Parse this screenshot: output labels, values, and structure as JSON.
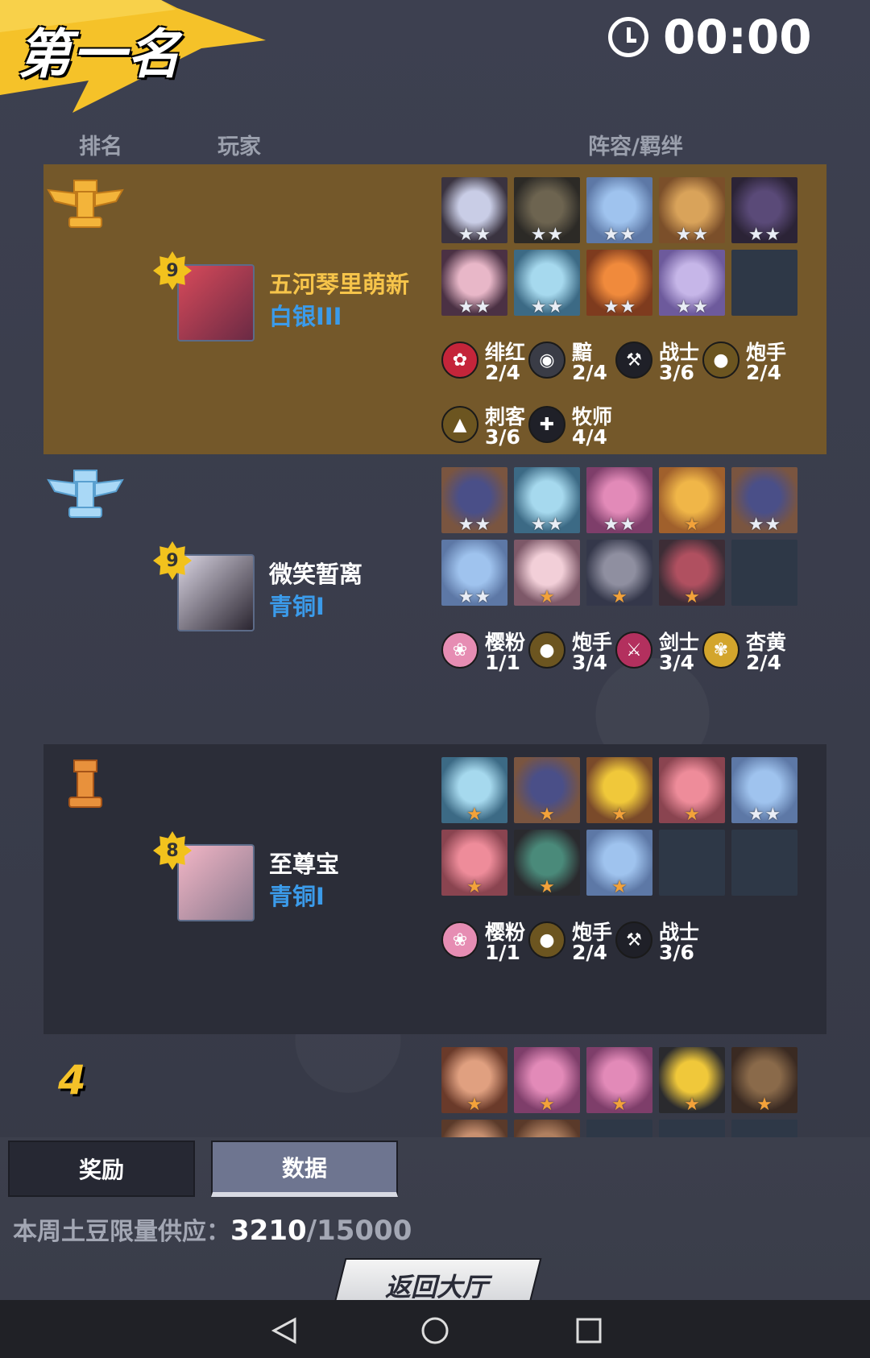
{
  "header": {
    "title": "第一名",
    "timer": "00:00",
    "clock_icon": "clock-icon"
  },
  "columns": {
    "rank": "排名",
    "player": "玩家",
    "lineup": "阵容/羁绊"
  },
  "rows": [
    {
      "rank_icon": "gold-rook-winged-icon",
      "level": "9",
      "name": "五河琴里萌新",
      "tier": "白银III",
      "name_color": "#f6c44a",
      "units": [
        {
          "c1": "#c9cde6",
          "c2": "#3a3340",
          "stars": 2,
          "gold": false
        },
        {
          "c1": "#6d6450",
          "c2": "#2c2a26",
          "stars": 2,
          "gold": false
        },
        {
          "c1": "#9fc3ee",
          "c2": "#5d78a6",
          "stars": 2,
          "gold": false
        },
        {
          "c1": "#d9a35a",
          "c2": "#7b4f2a",
          "stars": 2,
          "gold": false
        },
        {
          "c1": "#5a4a78",
          "c2": "#2b2336",
          "stars": 2,
          "gold": false
        },
        {
          "c1": "#e8b7c8",
          "c2": "#4b3144",
          "stars": 2,
          "gold": false
        },
        {
          "c1": "#a6d9ee",
          "c2": "#3c6a85",
          "stars": 2,
          "gold": false
        },
        {
          "c1": "#f08a3c",
          "c2": "#7e3b1e",
          "stars": 2,
          "gold": false
        },
        {
          "c1": "#c6b6e8",
          "c2": "#6d5a9c",
          "stars": 2,
          "gold": false
        },
        {
          "empty": true
        }
      ],
      "traits": [
        {
          "icon": "rose-icon",
          "glyph": "✿",
          "bg": "#c4253a",
          "name": "绯红",
          "count": "2/4"
        },
        {
          "icon": "eye-icon",
          "glyph": "◉",
          "bg": "#3a3c46",
          "name": "黯",
          "count": "2/4"
        },
        {
          "icon": "hammer-icon",
          "glyph": "⚒",
          "bg": "#1f2028",
          "name": "战士",
          "count": "3/6"
        },
        {
          "icon": "bomb-icon",
          "glyph": "●",
          "bg": "#6c5520",
          "name": "炮手",
          "count": "2/4"
        },
        {
          "icon": "dagger-icon",
          "glyph": "▲",
          "bg": "#6c5520",
          "name": "刺客",
          "count": "3/6"
        },
        {
          "icon": "cross-icon",
          "glyph": "✚",
          "bg": "#1f2028",
          "name": "牧师",
          "count": "4/4"
        }
      ]
    },
    {
      "rank_icon": "silver-rook-winged-icon",
      "level": "9",
      "name": "微笑暂离",
      "tier": "青铜I",
      "name_color": "#ffffff",
      "units": [
        {
          "c1": "#4a4f88",
          "c2": "#7a5540",
          "stars": 2,
          "gold": false
        },
        {
          "c1": "#a6d9ee",
          "c2": "#3c6a85",
          "stars": 2,
          "gold": false
        },
        {
          "c1": "#e28ab8",
          "c2": "#7e3e6a",
          "stars": 2,
          "gold": false
        },
        {
          "c1": "#f0b648",
          "c2": "#a0602c",
          "stars": 1,
          "gold": true
        },
        {
          "c1": "#4a4f88",
          "c2": "#7a5540",
          "stars": 2,
          "gold": false
        },
        {
          "c1": "#9fc3ee",
          "c2": "#5d78a6",
          "stars": 2,
          "gold": false
        },
        {
          "c1": "#f2cfd8",
          "c2": "#7d5868",
          "stars": 1,
          "gold": true
        },
        {
          "c1": "#8f8fa0",
          "c2": "#34374a",
          "stars": 1,
          "gold": true
        },
        {
          "c1": "#b05060",
          "c2": "#3d2d36",
          "stars": 1,
          "gold": true
        },
        {
          "empty": true
        }
      ],
      "traits": [
        {
          "icon": "sakura-icon",
          "glyph": "❀",
          "bg": "#e68db3",
          "name": "樱粉",
          "count": "1/1"
        },
        {
          "icon": "bomb-icon",
          "glyph": "●",
          "bg": "#6c5520",
          "name": "炮手",
          "count": "3/4"
        },
        {
          "icon": "sword-icon",
          "glyph": "⚔",
          "bg": "#b3305e",
          "name": "剑士",
          "count": "3/4"
        },
        {
          "icon": "lotus-icon",
          "glyph": "✾",
          "bg": "#d3a52c",
          "name": "杏黄",
          "count": "2/4"
        }
      ]
    },
    {
      "rank_icon": "bronze-rook-icon",
      "level": "8",
      "name": "至尊宝",
      "tier": "青铜I",
      "name_color": "#ffffff",
      "units": [
        {
          "c1": "#a6d9ee",
          "c2": "#3c6a85",
          "stars": 1,
          "gold": true
        },
        {
          "c1": "#4a4f88",
          "c2": "#7a5540",
          "stars": 1,
          "gold": true
        },
        {
          "c1": "#f0c83a",
          "c2": "#7a4a2a",
          "stars": 1,
          "gold": true
        },
        {
          "c1": "#ee8c9a",
          "c2": "#8a4450",
          "stars": 1,
          "gold": true
        },
        {
          "c1": "#9fc3ee",
          "c2": "#5d78a6",
          "stars": 2,
          "gold": false
        },
        {
          "c1": "#ee8c9a",
          "c2": "#8a4450",
          "stars": 1,
          "gold": true
        },
        {
          "c1": "#4a8a7a",
          "c2": "#2a2a2e",
          "stars": 1,
          "gold": true
        },
        {
          "c1": "#9fc3ee",
          "c2": "#5d78a6",
          "stars": 1,
          "gold": true
        },
        {
          "empty": true
        },
        {
          "empty": true
        }
      ],
      "traits": [
        {
          "icon": "sakura-icon",
          "glyph": "❀",
          "bg": "#e68db3",
          "name": "樱粉",
          "count": "1/1"
        },
        {
          "icon": "bomb-icon",
          "glyph": "●",
          "bg": "#6c5520",
          "name": "炮手",
          "count": "2/4"
        },
        {
          "icon": "hammer-icon",
          "glyph": "⚒",
          "bg": "#1f2028",
          "name": "战士",
          "count": "3/6"
        }
      ]
    },
    {
      "rank_icon": "rank-number",
      "rank_number": "4",
      "level": "",
      "units": [
        {
          "c1": "#e0a080",
          "c2": "#6a3a2a",
          "stars": 1,
          "gold": true
        },
        {
          "c1": "#e28ab8",
          "c2": "#7e3e6a",
          "stars": 1,
          "gold": true
        },
        {
          "c1": "#e28ab8",
          "c2": "#7e3e6a",
          "stars": 1,
          "gold": true
        },
        {
          "c1": "#f0c83a",
          "c2": "#2a2a2e",
          "stars": 1,
          "gold": true
        },
        {
          "c1": "#8a6a4a",
          "c2": "#3a2a22",
          "stars": 1,
          "gold": true
        },
        {
          "c1": "#c89070",
          "c2": "#5a3a2a",
          "stars": 0,
          "gold": false
        },
        {
          "c1": "#b08060",
          "c2": "#5a3a2a",
          "stars": 0,
          "gold": false
        },
        {
          "empty": true
        },
        {
          "empty": true
        },
        {
          "empty": true
        }
      ],
      "traits": []
    }
  ],
  "tabs": {
    "reward": "奖励",
    "data": "数据"
  },
  "supply": {
    "label": "本周土豆限量供应：",
    "current": "3210",
    "total": "/15000"
  },
  "back_button": "返回大厅",
  "navbar": {
    "back": "nav-back-icon",
    "home": "nav-home-icon",
    "recent": "nav-recent-icon"
  }
}
